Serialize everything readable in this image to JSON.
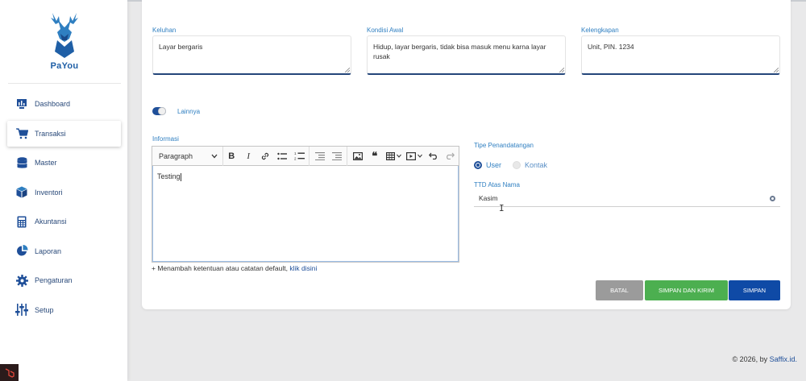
{
  "brand": {
    "prefix": "Pa",
    "suffix": "You"
  },
  "sidebar": {
    "items": [
      {
        "label": "Dashboard",
        "icon": "dashboard-icon"
      },
      {
        "label": "Transaksi",
        "icon": "cart-icon",
        "active": true
      },
      {
        "label": "Master",
        "icon": "database-icon"
      },
      {
        "label": "Inventori",
        "icon": "box-icon"
      },
      {
        "label": "Akuntansi",
        "icon": "calculator-icon"
      },
      {
        "label": "Laporan",
        "icon": "pie-chart-icon"
      },
      {
        "label": "Pengaturan",
        "icon": "gear-icon"
      },
      {
        "label": "Setup",
        "icon": "sliders-icon"
      }
    ]
  },
  "form": {
    "keluhan": {
      "label": "Keluhan",
      "value": "Layar bergaris"
    },
    "kondisi": {
      "label": "Kondisi Awal",
      "value": "Hidup, layar bergaris, tidak bisa masuk menu karna layar rusak"
    },
    "kelengkapan": {
      "label": "Kelengkapan",
      "value": "Unit, PIN. 1234"
    },
    "lainnya": {
      "label": "Lainnya",
      "checked": true
    },
    "informasi": {
      "label": "Informasi",
      "paragraph_select": "Paragraph",
      "content": "Testing"
    },
    "hint": {
      "text": "+ Menambah ketentuan atau catatan default,",
      "link": "klik disini"
    },
    "tipe": {
      "label": "Tipe Penandatangan",
      "options": [
        "User",
        "Kontak"
      ],
      "selected": "User"
    },
    "ttd": {
      "label": "TTD Atas Nama",
      "value": "Kasim"
    }
  },
  "buttons": {
    "batal": "BATAL",
    "simpan_kirim": "SIMPAN DAN KIRIM",
    "simpan": "SIMPAN"
  },
  "footer": {
    "text": "© 2026, by",
    "link": "Saffix.id."
  },
  "colors": {
    "primary": "#0f4aa6",
    "accent_label": "#2f7fc1",
    "success": "#4caf50",
    "muted": "#9b9b9b"
  }
}
